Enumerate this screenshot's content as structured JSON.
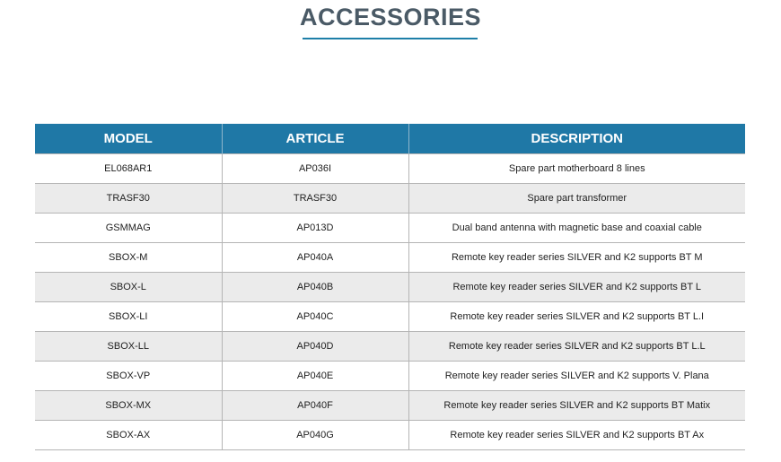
{
  "title": "ACCESSORIES",
  "colors": {
    "header_bg": "#1f78a6",
    "title_text": "#4a5a66",
    "underline": "#1e7fa8",
    "alt_row": "#ebebeb"
  },
  "table": {
    "headers": [
      "MODEL",
      "ARTICLE",
      "DESCRIPTION"
    ],
    "rows": [
      [
        "EL068AR1",
        "AP036I",
        "Spare part motherboard 8 lines"
      ],
      [
        "TRASF30",
        "TRASF30",
        "Spare part transformer"
      ],
      [
        "GSMMAG",
        "AP013D",
        "Dual band antenna with magnetic base and coaxial cable"
      ],
      [
        "SBOX-M",
        "AP040A",
        "Remote key reader series SILVER and K2 supports BT M"
      ],
      [
        "SBOX-L",
        "AP040B",
        "Remote key reader series SILVER and K2 supports BT L"
      ],
      [
        "SBOX-LI",
        "AP040C",
        "Remote key reader series SILVER and K2 supports BT L.I"
      ],
      [
        "SBOX-LL",
        "AP040D",
        "Remote key reader series SILVER and K2 supports BT L.L"
      ],
      [
        "SBOX-VP",
        "AP040E",
        "Remote key reader series SILVER and K2 supports V. Plana"
      ],
      [
        "SBOX-MX",
        "AP040F",
        "Remote key reader series SILVER and K2 supports BT Matix"
      ],
      [
        "SBOX-AX",
        "AP040G",
        "Remote key reader series SILVER and K2 supports BT Ax"
      ]
    ]
  }
}
